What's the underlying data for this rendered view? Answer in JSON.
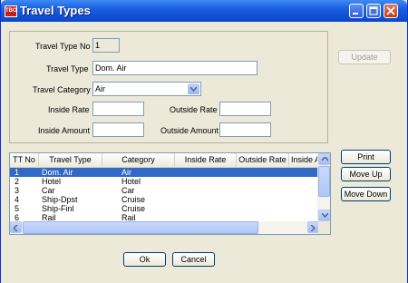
{
  "window": {
    "title": "Travel Types",
    "app_icon_text": "TBO"
  },
  "form": {
    "travel_type_no_label": "Travel Type No",
    "travel_type_no_value": "1",
    "travel_type_label": "Travel Type",
    "travel_type_value": "Dom. Air",
    "travel_category_label": "Travel Category",
    "travel_category_value": "Air",
    "inside_rate_label": "Inside Rate",
    "inside_rate_value": "",
    "outside_rate_label": "Outside Rate",
    "outside_rate_value": "",
    "inside_amount_label": "Inside Amount",
    "inside_amount_value": "",
    "outside_amount_label": "Outside Amount",
    "outside_amount_value": ""
  },
  "buttons": {
    "update": "Update",
    "print": "Print",
    "move_up": "Move Up",
    "move_down": "Move Down",
    "ok": "Ok",
    "cancel": "Cancel"
  },
  "list": {
    "columns": [
      "TT No",
      "Travel Type",
      "Category",
      "Inside Rate",
      "Outside Rate",
      "Inside Ar"
    ],
    "rows": [
      {
        "no": "1",
        "type": "Dom. Air",
        "category": "Air",
        "selected": true
      },
      {
        "no": "2",
        "type": "Hotel",
        "category": "Hotel",
        "selected": false
      },
      {
        "no": "3",
        "type": "Car",
        "category": "Car",
        "selected": false
      },
      {
        "no": "4",
        "type": "Ship-Dpst",
        "category": "Cruise",
        "selected": false
      },
      {
        "no": "5",
        "type": "Ship-Finl",
        "category": "Cruise",
        "selected": false
      },
      {
        "no": "6",
        "type": "Rail",
        "category": "Rail",
        "selected": false
      }
    ]
  },
  "colors": {
    "titlebar": "#0a46c9",
    "selection": "#316ac5",
    "face": "#ece9d8"
  }
}
